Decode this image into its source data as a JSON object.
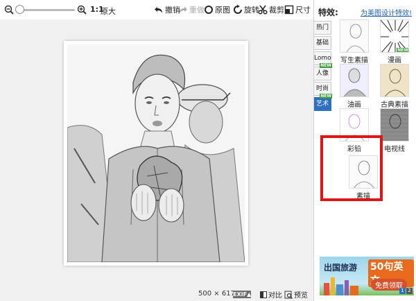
{
  "toolbar": {
    "zoom_ratio": "1:1",
    "original_size": "原大",
    "undo": "撤销",
    "redo": "重做",
    "original_image": "原图",
    "rotate": "旋转",
    "crop": "裁剪",
    "size": "尺寸"
  },
  "status": {
    "width": "500",
    "times": "×",
    "height": "617",
    "exif": "EXIF▲",
    "compare": "对比",
    "preview": "预览"
  },
  "panel": {
    "title": "特效:",
    "link": "为美图设计特效!",
    "tabs": [
      {
        "label": "热门"
      },
      {
        "label": "基础"
      },
      {
        "label": "Lomo"
      },
      {
        "label": "人像",
        "badge": "NEW"
      },
      {
        "label": "时尚"
      },
      {
        "label": "艺术",
        "badge": "NEW"
      }
    ],
    "effects": [
      {
        "label": "写生素描"
      },
      {
        "label": "漫画",
        "badge": "NEW"
      },
      {
        "label": "油画"
      },
      {
        "label": "古典素描"
      },
      {
        "label": "彩铅"
      },
      {
        "label": "电视线"
      },
      {
        "label": "素描"
      }
    ]
  },
  "ad": {
    "text1": "出国旅游",
    "text2": "50句英文",
    "button": "免费领取",
    "pages": [
      "1",
      "2"
    ]
  },
  "colors": {
    "accent": "#2f6fc0",
    "highlight": "#e01515",
    "new_badge": "#3aa03a"
  }
}
